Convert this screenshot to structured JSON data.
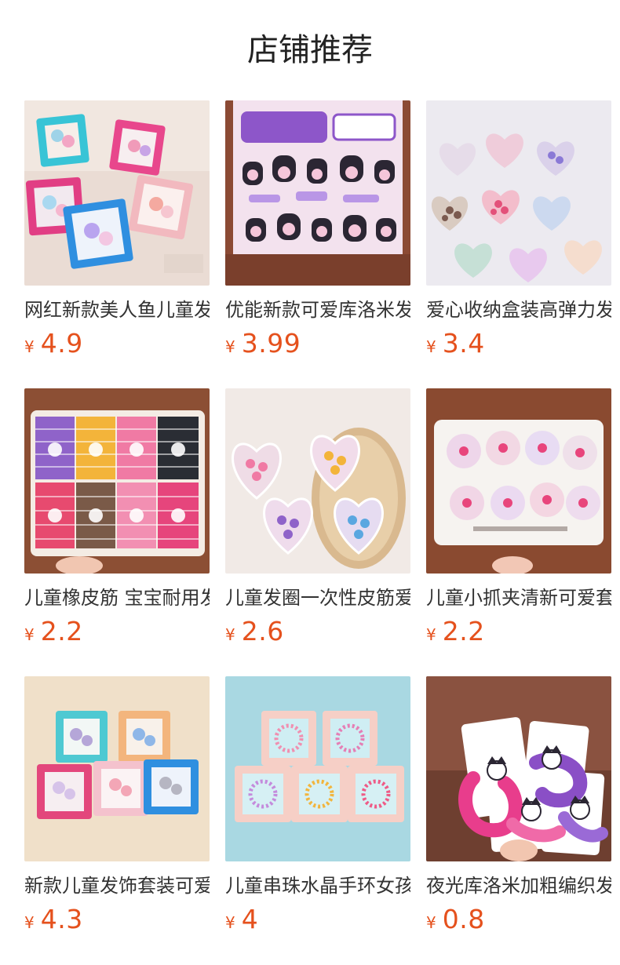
{
  "section": {
    "title": "店铺推荐"
  },
  "currency": "¥",
  "colors": {
    "price": "#e5511d",
    "title": "#222222",
    "text": "#333333"
  },
  "products": [
    {
      "name": "网红新款美人鱼儿童发饰套装",
      "price": "4.9",
      "image": "mermaid-hair-accessory-boxes"
    },
    {
      "name": "优能新款可爱库洛米发夹十四件套",
      "price": "3.99",
      "image": "kuromi-hair-clips-card"
    },
    {
      "name": "爱心收纳盒装高弹力发圈",
      "price": "3.4",
      "image": "heart-boxes-hair-ties"
    },
    {
      "name": "儿童橡皮筋 宝宝耐用发圈",
      "price": "2.2",
      "image": "rubber-band-organizer-box"
    },
    {
      "name": "儿童发圈一次性皮筋爱心盒",
      "price": "2.6",
      "image": "heart-shaped-hair-tie-boxes"
    },
    {
      "name": "儿童小抓夹清新可爱套装",
      "price": "2.2",
      "image": "mini-claw-clip-tray"
    },
    {
      "name": "新款儿童发饰套装可爱礼盒",
      "price": "4.3",
      "image": "kids-hair-accessory-gift-boxes"
    },
    {
      "name": "儿童串珠水晶手环女孩",
      "price": "4",
      "image": "beaded-crystal-bracelet-boxes"
    },
    {
      "name": "夜光库洛米加粗编织发圈",
      "price": "0.8",
      "image": "kuromi-braided-scrunchies"
    }
  ]
}
